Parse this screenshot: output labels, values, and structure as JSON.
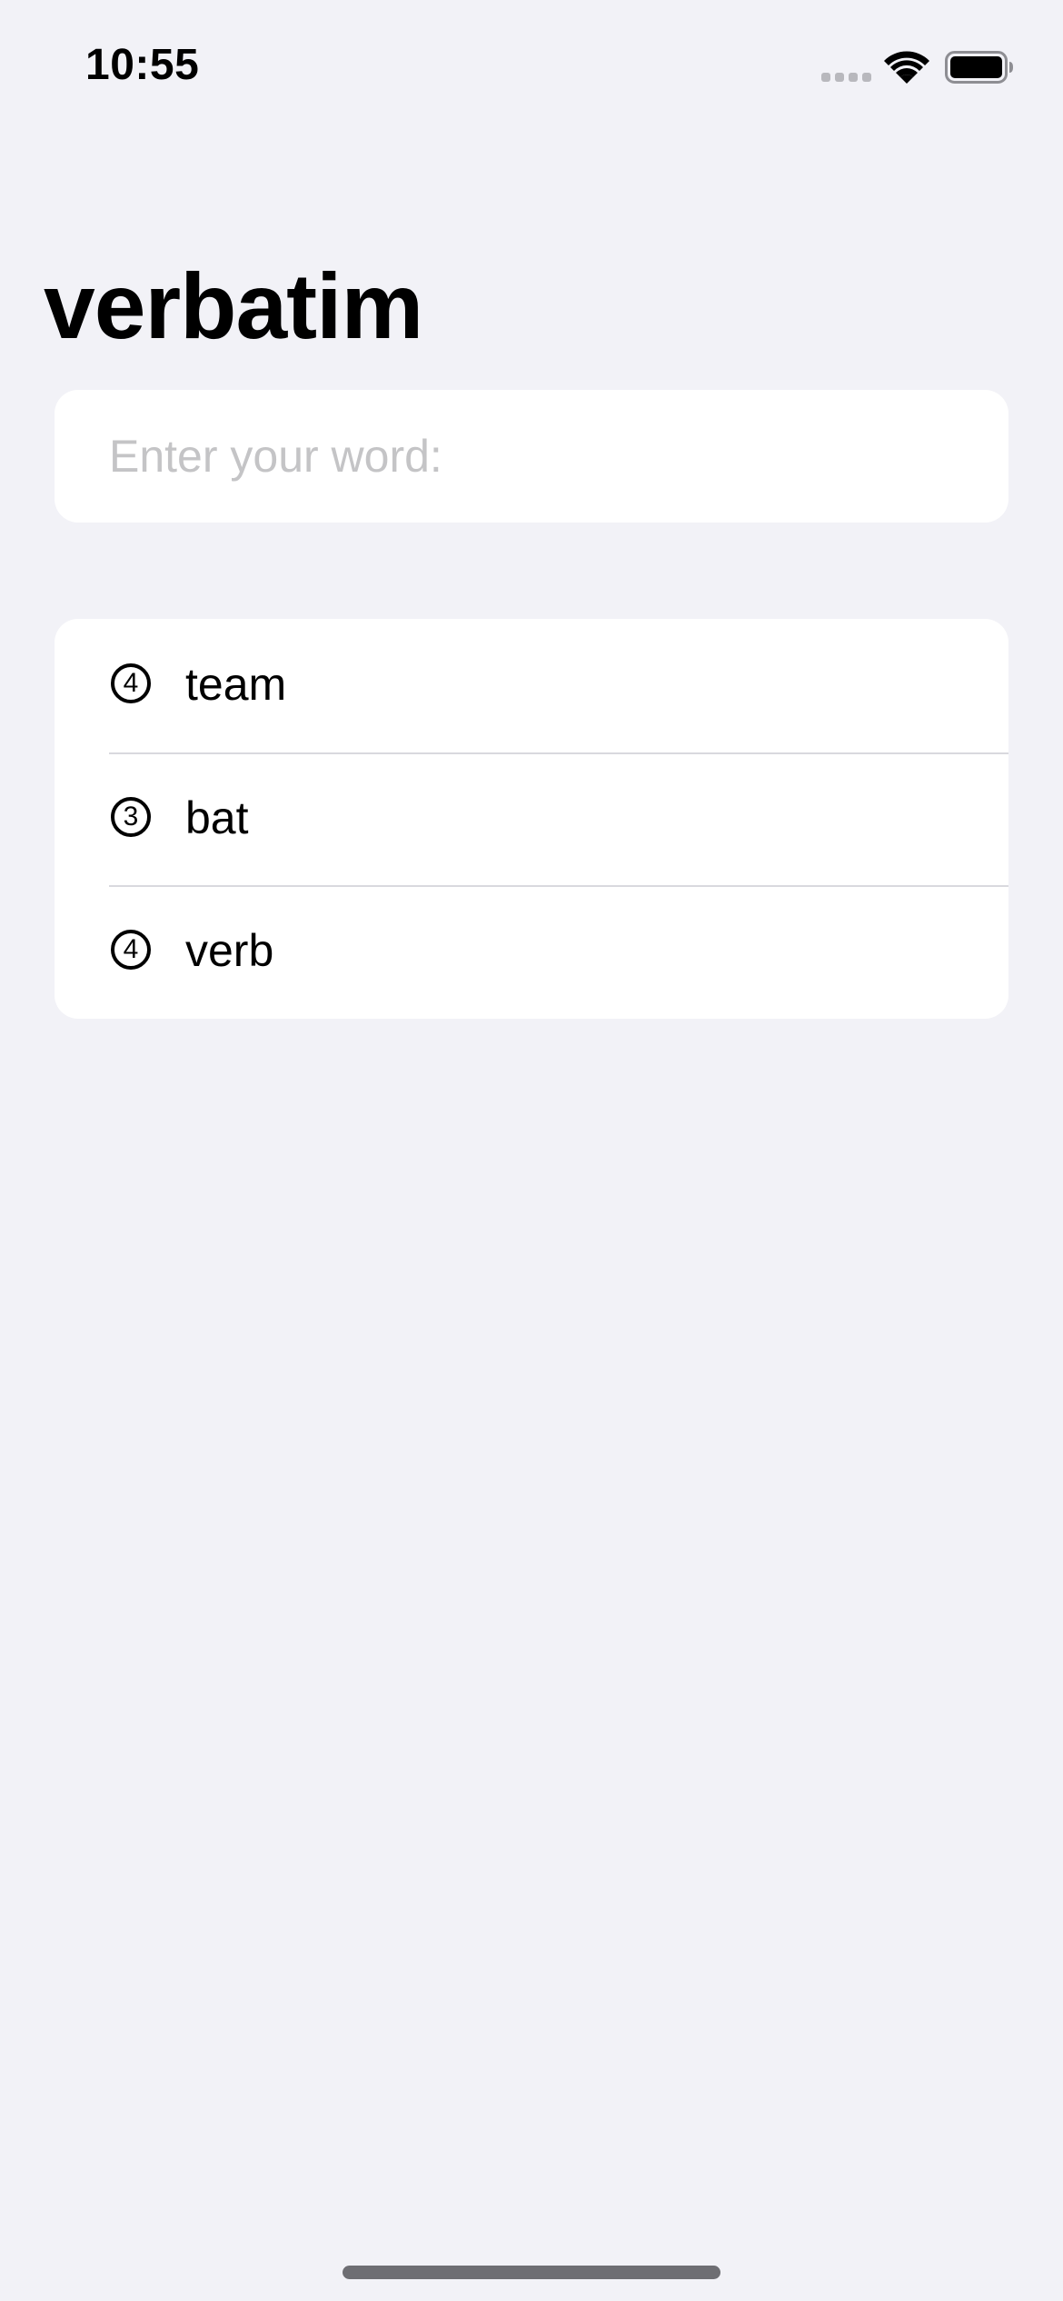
{
  "status_bar": {
    "time": "10:55"
  },
  "header": {
    "title": "verbatim"
  },
  "word_input": {
    "value": "",
    "placeholder": "Enter your word:"
  },
  "words": [
    {
      "count": "4",
      "word": "team"
    },
    {
      "count": "3",
      "word": "bat"
    },
    {
      "count": "4",
      "word": "verb"
    }
  ],
  "colors": {
    "background": "#f2f2f7",
    "card": "#ffffff",
    "placeholder": "#c4c4c6",
    "separator": "#d9d9de"
  },
  "icons": {
    "signal": "cellular-signal-icon",
    "wifi": "wifi-icon",
    "battery": "battery-icon"
  }
}
